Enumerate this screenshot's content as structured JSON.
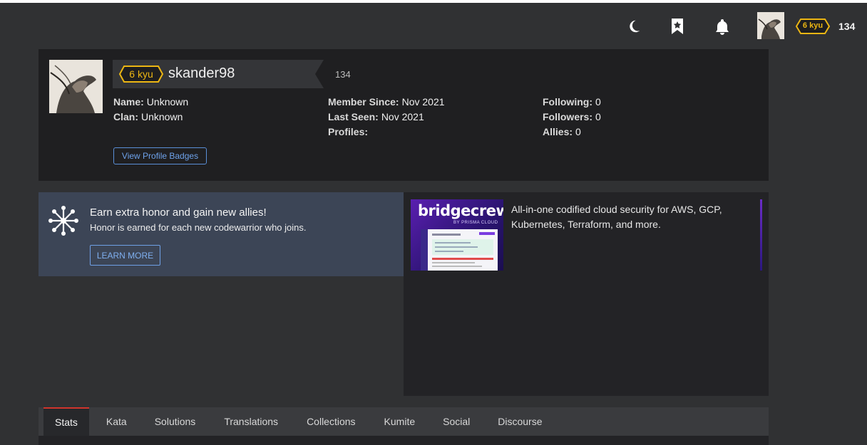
{
  "topbar": {
    "icons": [
      "moon-icon",
      "bookmark-icon",
      "bell-icon"
    ],
    "rank": "6 kyu",
    "honor": "134"
  },
  "profile": {
    "rank": "6 kyu",
    "username": "skander98",
    "honor": "134",
    "fields": {
      "name_label": "Name:",
      "name_value": "Unknown",
      "clan_label": "Clan:",
      "clan_value": "Unknown",
      "member_since_label": "Member Since:",
      "member_since_value": "Nov 2021",
      "last_seen_label": "Last Seen:",
      "last_seen_value": "Nov 2021",
      "profiles_label": "Profiles:",
      "following_label": "Following:",
      "following_value": "0",
      "followers_label": "Followers:",
      "followers_value": "0",
      "allies_label": "Allies:",
      "allies_value": "0"
    },
    "badges_button": "View Profile Badges"
  },
  "referral": {
    "title": "Earn extra honor and gain new allies!",
    "subtitle": "Honor is earned for each new codewarrior who joins.",
    "button": "LEARN MORE"
  },
  "ad": {
    "logo": "bridgecrew",
    "sublogo": "BY PRISMA CLOUD",
    "text": "All-in-one codified cloud security for AWS, GCP, Kubernetes, Terraform, and more."
  },
  "tabs": [
    {
      "label": "Stats",
      "active": true
    },
    {
      "label": "Kata"
    },
    {
      "label": "Solutions"
    },
    {
      "label": "Translations"
    },
    {
      "label": "Collections"
    },
    {
      "label": "Kumite"
    },
    {
      "label": "Social"
    },
    {
      "label": "Discourse"
    }
  ],
  "colors": {
    "rank_yellow": "#ecb613",
    "accent_blue": "#6da2ea",
    "active_tab": "#d0342c"
  }
}
